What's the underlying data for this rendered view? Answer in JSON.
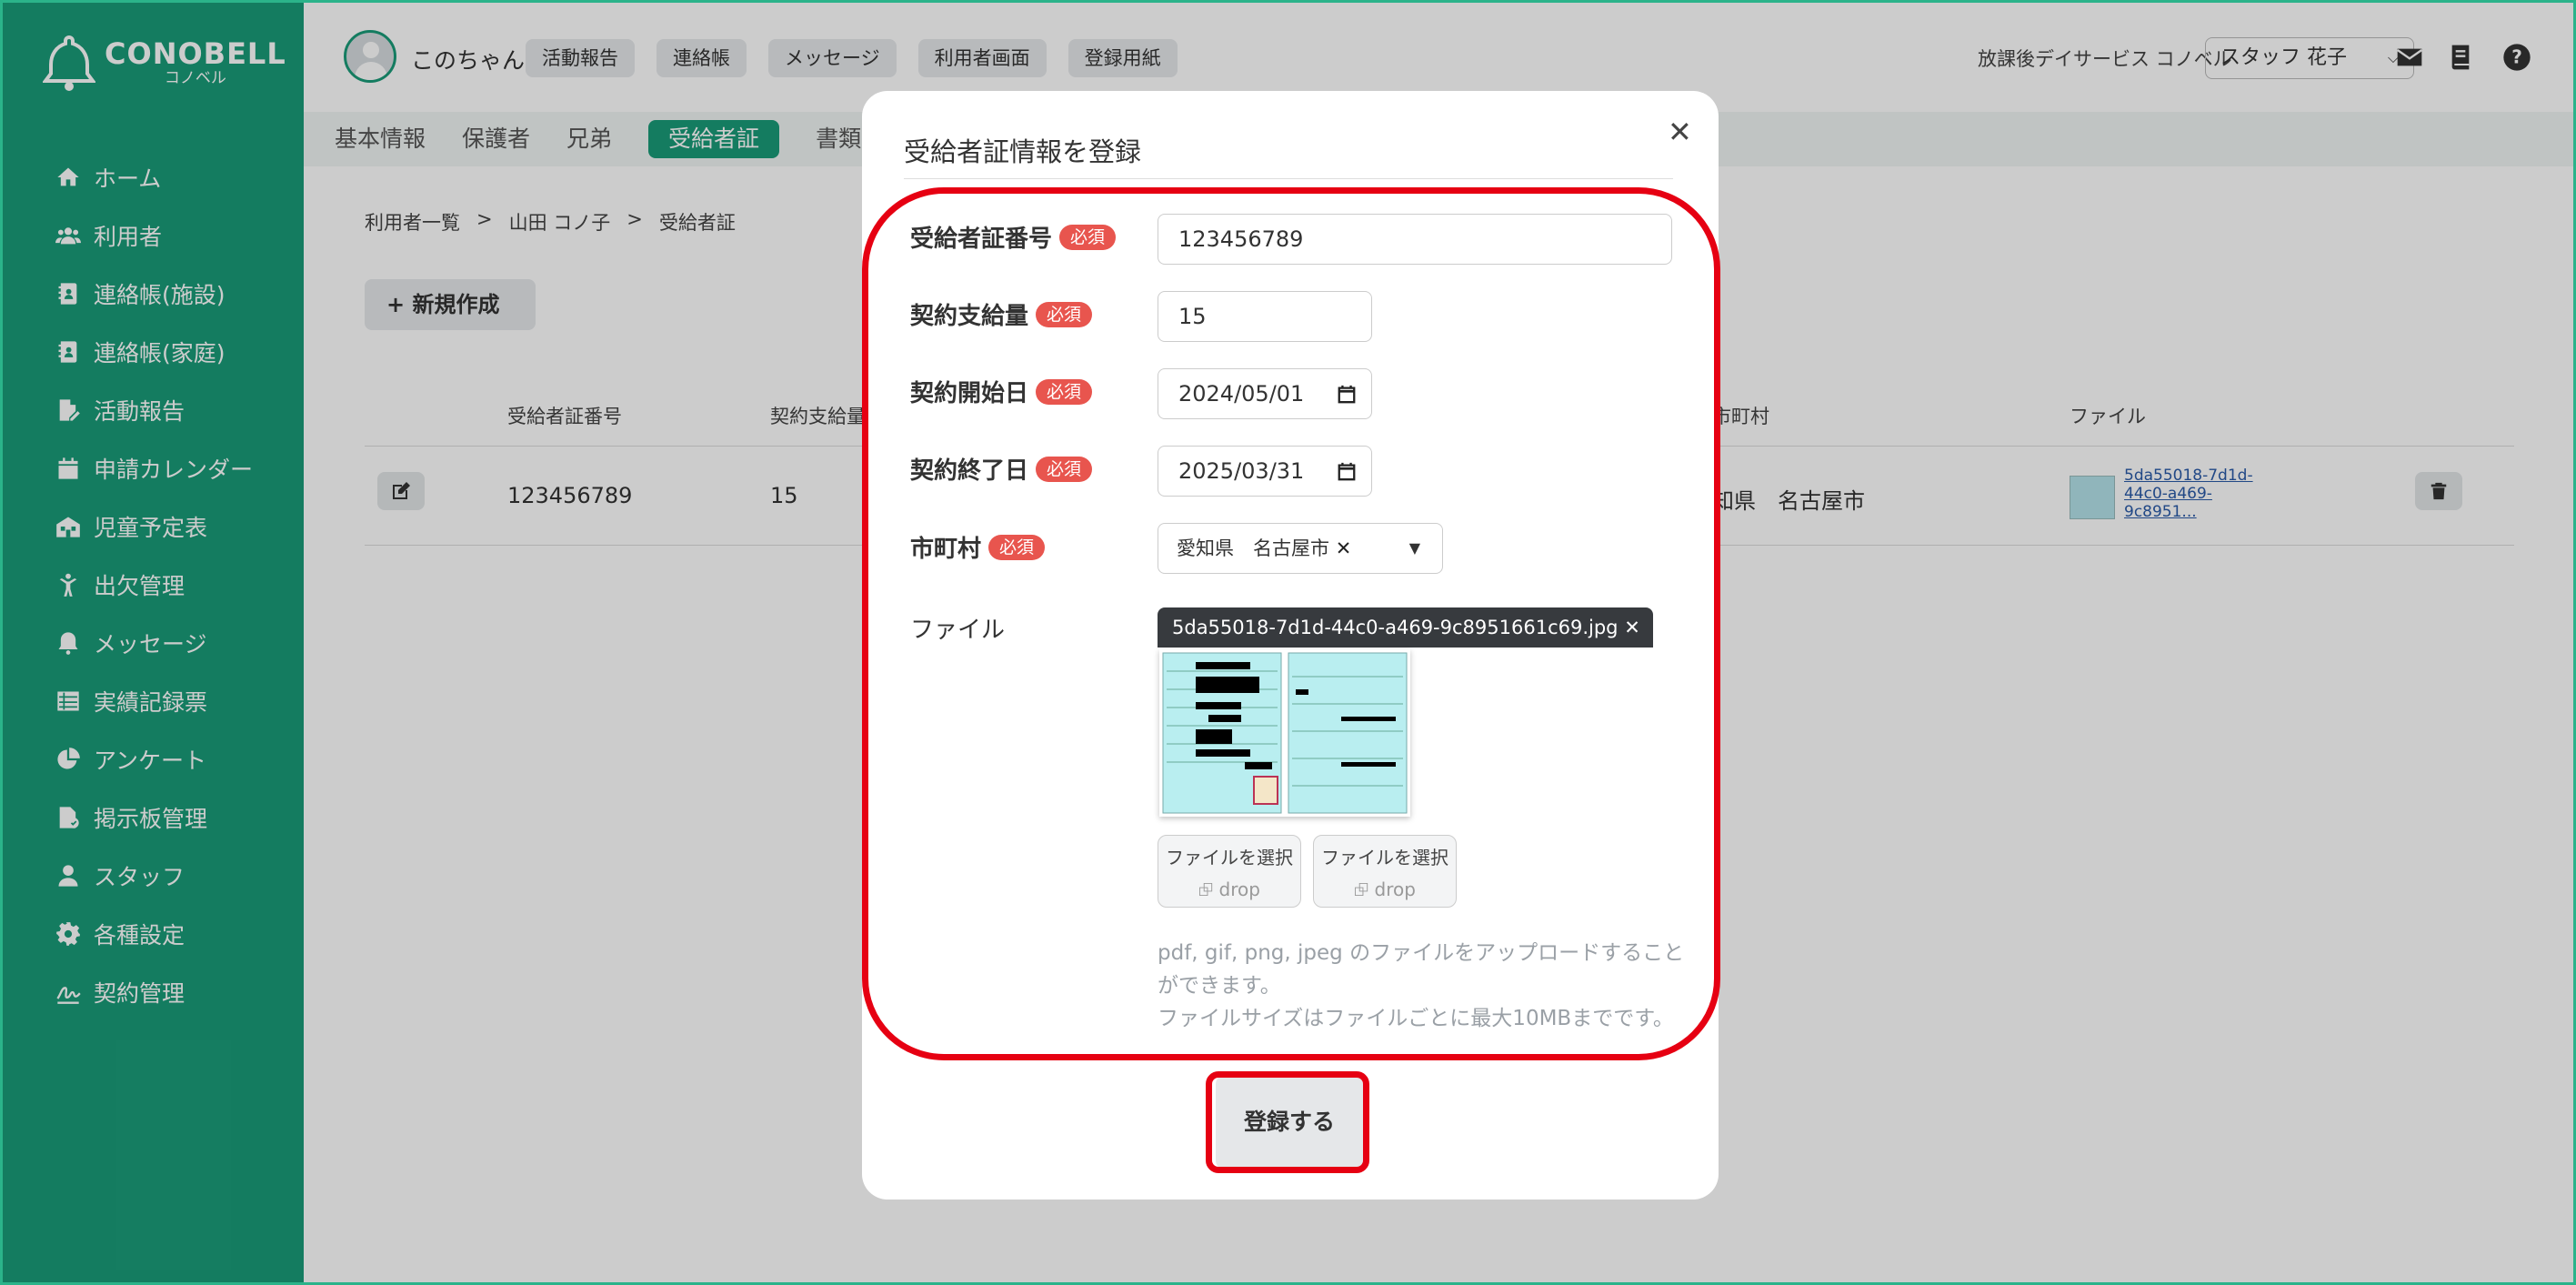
{
  "app": {
    "logo_main": "CONOBELL",
    "logo_sub": "コノベル"
  },
  "sidebar": {
    "items": [
      {
        "label": "ホーム",
        "icon": "home-icon"
      },
      {
        "label": "利用者",
        "icon": "users-icon"
      },
      {
        "label": "連絡帳(施設)",
        "icon": "contact-book-icon"
      },
      {
        "label": "連絡帳(家庭)",
        "icon": "contact-book-icon"
      },
      {
        "label": "活動報告",
        "icon": "report-icon"
      },
      {
        "label": "申請カレンダー",
        "icon": "calendar-icon"
      },
      {
        "label": "児童予定表",
        "icon": "schedule-icon"
      },
      {
        "label": "出欠管理",
        "icon": "attendance-icon"
      },
      {
        "label": "メッセージ",
        "icon": "bell-icon"
      },
      {
        "label": "実績記録票",
        "icon": "table-icon"
      },
      {
        "label": "アンケート",
        "icon": "pie-chart-icon"
      },
      {
        "label": "掲示板管理",
        "icon": "board-icon"
      },
      {
        "label": "スタッフ",
        "icon": "staff-icon"
      },
      {
        "label": "各種設定",
        "icon": "gear-icon"
      },
      {
        "label": "契約管理",
        "icon": "contract-icon"
      }
    ]
  },
  "header": {
    "user_name": "このちゃん",
    "buttons": [
      "活動報告",
      "連絡帳",
      "メッセージ",
      "利用者画面",
      "登録用紙"
    ],
    "facility": "放課後デイサービス コノベル",
    "staff_select": "スタッフ 花子"
  },
  "tabs": [
    {
      "label": "基本情報",
      "active": false
    },
    {
      "label": "保護者",
      "active": false
    },
    {
      "label": "兄弟",
      "active": false
    },
    {
      "label": "受給者証",
      "active": true
    },
    {
      "label": "書類",
      "active": false
    }
  ],
  "breadcrumb": [
    "利用者一覧",
    ">",
    "山田 コノ子",
    ">",
    "受給者証"
  ],
  "new_button": "新規作成",
  "table": {
    "headers": {
      "cert_no": "受給者証番号",
      "amount": "契約支給量",
      "city": "市町村",
      "file": "ファイル"
    },
    "row": {
      "cert_no": "123456789",
      "amount": "15",
      "city": "知県　名古屋市",
      "file_name": "5da55018-7d1d-44c0-a469-9c8951..."
    }
  },
  "modal": {
    "title": "受給者証情報を登録",
    "required_badge": "必須",
    "fields": {
      "cert_no_label": "受給者証番号",
      "cert_no_value": "123456789",
      "amount_label": "契約支給量",
      "amount_value": "15",
      "start_label": "契約開始日",
      "start_value": "2024/05/01",
      "end_label": "契約終了日",
      "end_value": "2025/03/31",
      "city_label": "市町村",
      "city_value": "愛知県　名古屋市",
      "file_label": "ファイル"
    },
    "file_tag": "5da55018-7d1d-44c0-a469-9c8951661c69.jpg",
    "choose_file": "ファイルを選択",
    "drop": "drop",
    "note_line1": "pdf, gif, png, jpeg のファイルをアップロードすることができます。",
    "note_line2": "ファイルサイズはファイルごとに最大10MBまでです。",
    "submit": "登録する"
  },
  "colors": {
    "brand": "#1a9c79",
    "required": "#e8554e",
    "annotation": "#e60012"
  }
}
